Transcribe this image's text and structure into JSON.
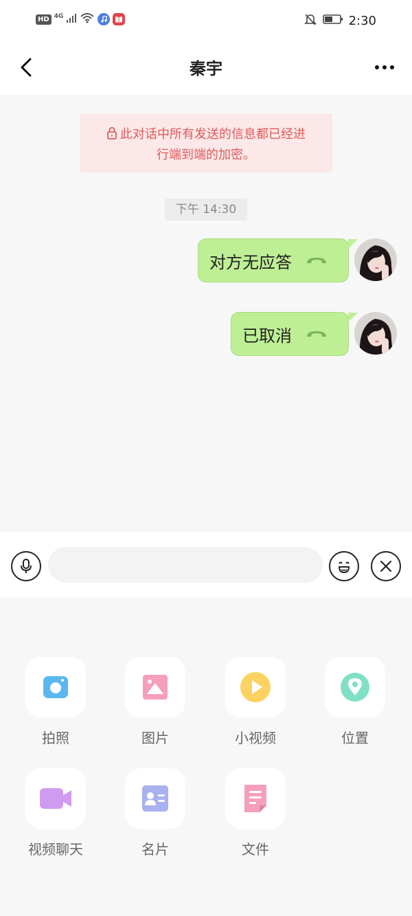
{
  "status_bar": {
    "hd": "HD",
    "network": "4G",
    "time": "2:30"
  },
  "header": {
    "title": "秦宇"
  },
  "chat": {
    "encryption_notice_line1": "此对话中所有发送的信息都已经进",
    "encryption_notice_line2": "行端到端的加密。",
    "timestamp": "下午 14:30",
    "messages": [
      {
        "text": "对方无应答",
        "type": "call"
      },
      {
        "text": "已取消",
        "type": "call"
      }
    ]
  },
  "input": {
    "placeholder": ""
  },
  "tools": [
    {
      "label": "拍照",
      "icon": "camera-icon",
      "color": "#5ab8ee"
    },
    {
      "label": "图片",
      "icon": "image-icon",
      "color": "#f59fbd"
    },
    {
      "label": "小视频",
      "icon": "video-play-icon",
      "color": "#fcd361"
    },
    {
      "label": "位置",
      "icon": "location-icon",
      "color": "#7fe0c5"
    },
    {
      "label": "视频聊天",
      "icon": "video-camera-icon",
      "color": "#cf9bf0"
    },
    {
      "label": "名片",
      "icon": "contact-card-icon",
      "color": "#a7b2ee"
    },
    {
      "label": "文件",
      "icon": "file-icon",
      "color": "#f59fbd"
    }
  ],
  "colors": {
    "bubble": "#bfef95",
    "notice_bg": "#fce8e8",
    "notice_text": "#e05a5a"
  }
}
